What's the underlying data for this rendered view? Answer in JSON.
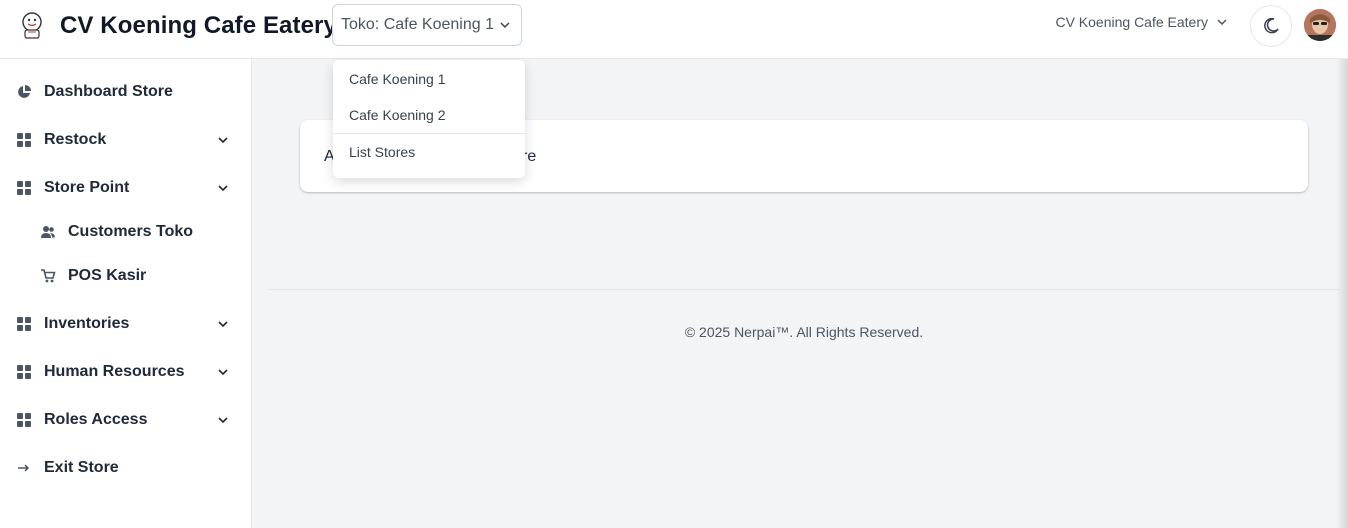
{
  "header": {
    "title": "CV Koening Cafe Eatery",
    "store_select": "Toko: Cafe Koening 1",
    "org_select": "CV Koening Cafe Eatery"
  },
  "store_dropdown": {
    "options": [
      "Cafe Koening 1",
      "Cafe Koening 2"
    ],
    "list_stores": "List Stores"
  },
  "sidebar": {
    "items": [
      {
        "label": "Dashboard Store",
        "icon": "pie-chart-icon"
      },
      {
        "label": "Restock",
        "icon": "grid-icon"
      },
      {
        "label": "Store Point",
        "icon": "grid-icon"
      },
      {
        "label": "Customers Toko",
        "icon": "users-icon"
      },
      {
        "label": "POS Kasir",
        "icon": "cart-icon"
      },
      {
        "label": "Inventories",
        "icon": "grid-icon"
      },
      {
        "label": "Human Resources",
        "icon": "grid-icon"
      },
      {
        "label": "Roles Access",
        "icon": "grid-icon"
      },
      {
        "label": "Exit Store",
        "icon": "arrow-right-icon"
      }
    ]
  },
  "main": {
    "card_message_start": "A",
    "card_message_end": "re"
  },
  "footer": {
    "text": "© 2025 Nerpai™. All Rights Reserved."
  }
}
